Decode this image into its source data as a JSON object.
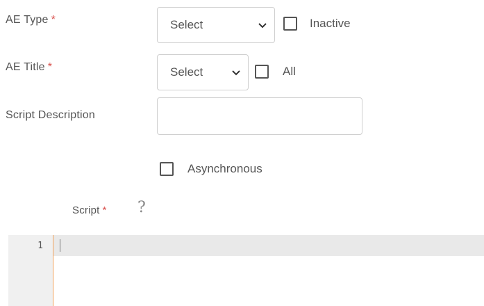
{
  "form": {
    "ae_type": {
      "label": "AE Type",
      "required": "*",
      "select_value": "Select",
      "checkbox_label": "Inactive"
    },
    "ae_title": {
      "label": "AE Title",
      "required": "*",
      "select_value": "Select",
      "checkbox_label": "All"
    },
    "script_description": {
      "label": "Script Description",
      "value": ""
    },
    "asynchronous": {
      "label": "Asynchronous"
    },
    "script": {
      "label": "Script",
      "required": "*",
      "help": "?"
    }
  },
  "editor": {
    "line_numbers": [
      "1"
    ]
  },
  "colors": {
    "required": "#d9534f",
    "gutter_border": "#f2a25a",
    "gutter_bg": "#f0f0f0",
    "active_line": "#e9e9e9"
  }
}
